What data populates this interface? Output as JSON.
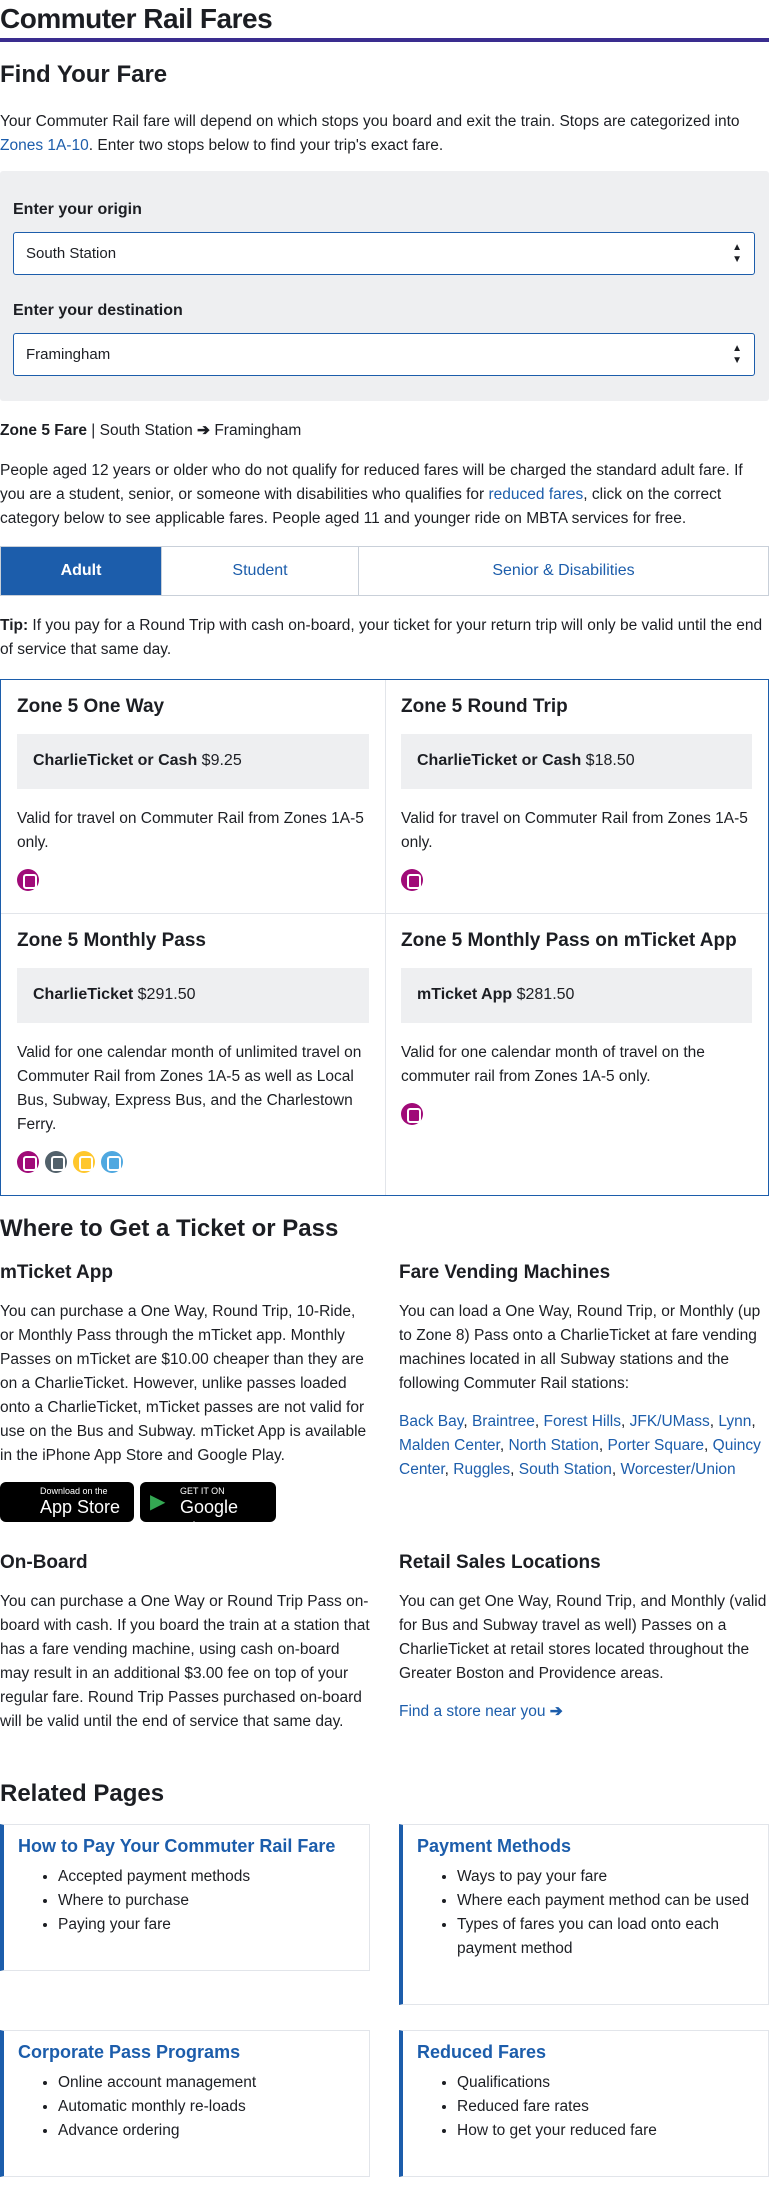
{
  "page": {
    "title": "Commuter Rail Fares"
  },
  "find": {
    "heading": "Find Your Fare",
    "intro_before": "Your Commuter Rail fare will depend on which stops you board and exit the train. Stops are categorized into ",
    "intro_link": "Zones 1A-10",
    "intro_after": ". Enter two stops below to find your trip's exact fare.",
    "origin_label": "Enter your origin",
    "origin_value": "South Station",
    "destination_label": "Enter your destination",
    "destination_value": "Framingham"
  },
  "zone": {
    "fare": "Zone 5 Fare",
    "sep": " | ",
    "from": "South Station",
    "to": "Framingham"
  },
  "desc": {
    "before": "People aged 12 years or older who do not qualify for reduced fares will be charged the standard adult fare. If you are a student, senior, or someone with disabilities who qualifies for ",
    "link": "reduced fares",
    "after": ", click on the correct category below to see applicable fares. People aged 11 and younger ride on MBTA services for free."
  },
  "tabs": [
    "Adult",
    "Student",
    "Senior & Disabilities"
  ],
  "tip": {
    "label": "Tip:",
    "text": " If you pay for a Round Trip with cash on-board, your ticket for your return trip will only be valid until the end of service that same day."
  },
  "fares": [
    {
      "title": "Zone 5 One Way",
      "medium": "CharlieTicket or Cash",
      "price": "$9.25",
      "desc": "Valid for travel on Commuter Rail from Zones 1A-5 only."
    },
    {
      "title": "Zone 5 Round Trip",
      "medium": "CharlieTicket or Cash",
      "price": "$18.50",
      "desc": "Valid for travel on Commuter Rail from Zones 1A-5 only."
    },
    {
      "title": "Zone 5 Monthly Pass",
      "medium": "CharlieTicket",
      "price": "$291.50",
      "desc": "Valid for one calendar month of unlimited travel on Commuter Rail from Zones 1A-5 as well as Local Bus, Subway, Express Bus, and the Charlestown Ferry."
    },
    {
      "title": "Zone 5 Monthly Pass on mTicket App",
      "medium": "mTicket App",
      "price": "$281.50",
      "desc": "Valid for one calendar month of travel on the commuter rail from Zones 1A-5 only."
    }
  ],
  "mode_icons": {
    "commuter_rail": "#a00a78",
    "bus": "#52616b",
    "subway": "#ffc72c",
    "ferry": "#4fa8e0"
  },
  "where": {
    "heading": "Where to Get a Ticket or Pass",
    "mticket_title": "mTicket App",
    "mticket_text": "You can purchase a One Way, Round Trip, 10-Ride, or Monthly Pass through the mTicket app. Monthly Passes on mTicket are $10.00 cheaper than they are on a CharlieTicket. However, unlike passes loaded onto a CharlieTicket, mTicket passes are not valid for use on the Bus and Subway. mTicket App is available in the iPhone App Store and Google Play.",
    "appstore_small": "Download on the",
    "appstore_big": "App Store",
    "googleplay_small": "GET IT ON",
    "googleplay_big": "Google Play",
    "fvm_title": "Fare Vending Machines",
    "fvm_text": "You can load a One Way, Round Trip, or Monthly (up to Zone 8) Pass onto a CharlieTicket at fare vending machines located in all Subway stations and the following Commuter Rail stations:",
    "stations": [
      "Back Bay",
      "Braintree",
      "Forest Hills",
      "JFK/UMass",
      "Lynn",
      "Malden Center",
      "North Station",
      "Porter Square",
      "Quincy Center",
      "Ruggles",
      "South Station",
      "Worcester/Union"
    ],
    "onboard_title": "On-Board",
    "onboard_text": "You can purchase a One Way or Round Trip Pass on-board with cash. If you board the train at a station that has a fare vending machine, using cash on-board may result in an additional $3.00 fee on top of your regular fare. Round Trip Passes purchased on-board will be valid until the end of service that same day.",
    "retail_title": "Retail Sales Locations",
    "retail_text": "You can get One Way, Round Trip, and Monthly (valid for Bus and Subway travel as well) Passes on a CharlieTicket at retail stores located throughout the Greater Boston and Providence areas.",
    "store_link": "Find a store near you"
  },
  "related": {
    "heading": "Related Pages",
    "cards": [
      {
        "title": "How to Pay Your Commuter Rail Fare",
        "items": [
          "Accepted payment methods",
          "Where to purchase",
          "Paying your fare"
        ]
      },
      {
        "title": "Payment Methods",
        "items": [
          "Ways to pay your fare",
          "Where each payment method can be used",
          "Types of fares you can load onto each payment method"
        ]
      },
      {
        "title": "Corporate Pass Programs",
        "items": [
          "Online account management",
          "Automatic monthly re-loads",
          "Advance ordering"
        ]
      },
      {
        "title": "Reduced Fares",
        "items": [
          "Qualifications",
          "Reduced fare rates",
          "How to get your reduced fare"
        ]
      }
    ]
  }
}
